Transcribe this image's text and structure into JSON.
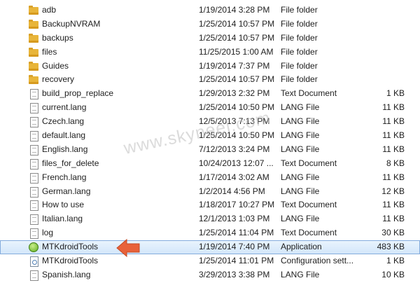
{
  "files": [
    {
      "name": "adb",
      "date": "1/19/2014 3:28 PM",
      "type": "File folder",
      "size": "",
      "icon": "folder-icon"
    },
    {
      "name": "BackupNVRAM",
      "date": "1/25/2014 10:57 PM",
      "type": "File folder",
      "size": "",
      "icon": "folder-icon"
    },
    {
      "name": "backups",
      "date": "1/25/2014 10:57 PM",
      "type": "File folder",
      "size": "",
      "icon": "folder-icon"
    },
    {
      "name": "files",
      "date": "11/25/2015 1:00 AM",
      "type": "File folder",
      "size": "",
      "icon": "folder-icon"
    },
    {
      "name": "Guides",
      "date": "1/19/2014 7:37 PM",
      "type": "File folder",
      "size": "",
      "icon": "folder-icon"
    },
    {
      "name": "recovery",
      "date": "1/25/2014 10:57 PM",
      "type": "File folder",
      "size": "",
      "icon": "folder-icon"
    },
    {
      "name": "build_prop_replace",
      "date": "1/29/2013 2:32 PM",
      "type": "Text Document",
      "size": "1 KB",
      "icon": "text-document-icon"
    },
    {
      "name": "current.lang",
      "date": "1/25/2014 10:50 PM",
      "type": "LANG File",
      "size": "11 KB",
      "icon": "document-icon"
    },
    {
      "name": "Czech.lang",
      "date": "12/5/2013 7:13 PM",
      "type": "LANG File",
      "size": "11 KB",
      "icon": "document-icon"
    },
    {
      "name": "default.lang",
      "date": "1/25/2014 10:50 PM",
      "type": "LANG File",
      "size": "11 KB",
      "icon": "document-icon"
    },
    {
      "name": "English.lang",
      "date": "7/12/2013 3:24 PM",
      "type": "LANG File",
      "size": "11 KB",
      "icon": "document-icon"
    },
    {
      "name": "files_for_delete",
      "date": "10/24/2013 12:07 ...",
      "type": "Text Document",
      "size": "8 KB",
      "icon": "text-document-icon"
    },
    {
      "name": "French.lang",
      "date": "1/17/2014 3:02 AM",
      "type": "LANG File",
      "size": "11 KB",
      "icon": "document-icon"
    },
    {
      "name": "German.lang",
      "date": "1/2/2014 4:56 PM",
      "type": "LANG File",
      "size": "12 KB",
      "icon": "document-icon"
    },
    {
      "name": "How to use",
      "date": "1/18/2017 10:27 PM",
      "type": "Text Document",
      "size": "11 KB",
      "icon": "text-document-icon"
    },
    {
      "name": "Italian.lang",
      "date": "12/1/2013 1:03 PM",
      "type": "LANG File",
      "size": "11 KB",
      "icon": "document-icon"
    },
    {
      "name": "log",
      "date": "1/25/2014 11:04 PM",
      "type": "Text Document",
      "size": "30 KB",
      "icon": "text-document-icon"
    },
    {
      "name": "MTKdroidTools",
      "date": "1/19/2014 7:40 PM",
      "type": "Application",
      "size": "483 KB",
      "icon": "application-icon",
      "selected": true
    },
    {
      "name": "MTKdroidTools",
      "date": "1/25/2014 11:01 PM",
      "type": "Configuration sett...",
      "size": "1 KB",
      "icon": "config-settings-icon"
    },
    {
      "name": "Spanish.lang",
      "date": "3/29/2013 3:38 PM",
      "type": "LANG File",
      "size": "10 KB",
      "icon": "document-icon"
    }
  ],
  "watermark": "www.skyneel.com",
  "colors": {
    "selection": "#d2e6fa",
    "selection_border": "#84acdd",
    "arrow": "#e8623a",
    "folder": "#e8b53a"
  }
}
